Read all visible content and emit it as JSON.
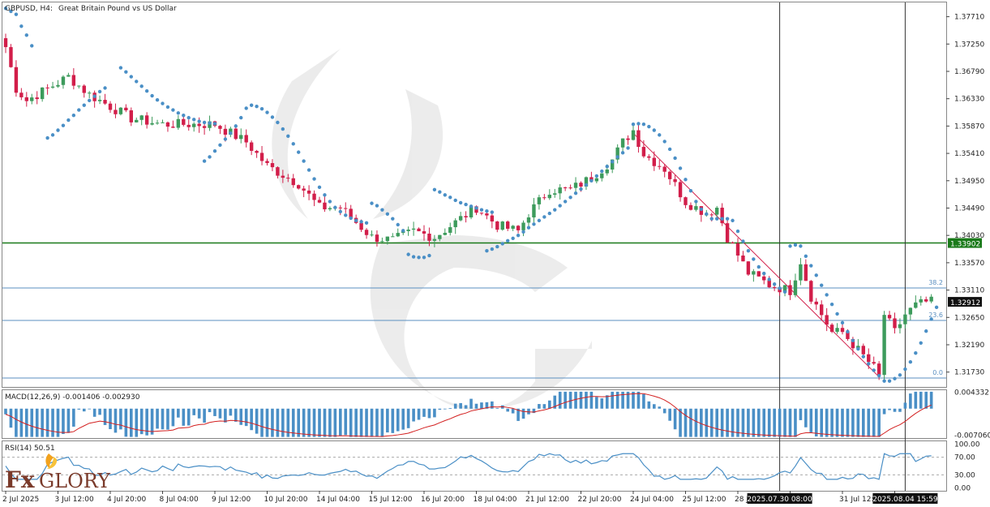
{
  "header": {
    "symbol": "GBPUSD, H4:",
    "description": "Great Britain Pound vs US Dollar"
  },
  "colors": {
    "bull": "#3d9b5c",
    "bear": "#d21e4a",
    "sar": "#4a8fc6",
    "macd_hist": "#4a8fc6",
    "signal": "#d32020",
    "rsi": "#4a8fc6",
    "level_line": "#1a7a1a",
    "fib": "#5b8fc0",
    "trendline": "#d21e4a"
  },
  "chart_data": [
    {
      "type": "candlestick",
      "title": "GBPUSD, H4:  Great Britain Pound vs US Dollar",
      "ylim": [
        1.3148,
        1.3795
      ],
      "y_ticks": [
        "1.37710",
        "1.37250",
        "1.36790",
        "1.36330",
        "1.35870",
        "1.35410",
        "1.34950",
        "1.34490",
        "1.34030",
        "1.33570",
        "1.33110",
        "1.32650",
        "1.32190",
        "1.31730"
      ],
      "y_tick_values": [
        1.3771,
        1.3725,
        1.3679,
        1.3633,
        1.3587,
        1.3541,
        1.3495,
        1.3449,
        1.3403,
        1.3357,
        1.3311,
        1.3265,
        1.3219,
        1.3173
      ],
      "x_ticks": [
        "2 Jul 2025",
        "3 Jul 12:00",
        "4 Jul 20:00",
        "8 Jul 04:00",
        "9 Jul 12:00",
        "10 Jul 20:00",
        "14 Jul 04:00",
        "15 Jul 12:00",
        "16 Jul 20:00",
        "18 Jul 04:00",
        "21 Jul 12:00",
        "22 Jul 20:00",
        "24 Jul 04:00",
        "25 Jul 12:00",
        "28 J",
        "",
        "31 Jul 12:00",
        ""
      ],
      "x_tick_bars": [
        0,
        10,
        20,
        30,
        40,
        50,
        60,
        70,
        80,
        90,
        100,
        110,
        120,
        130,
        140,
        150,
        160,
        170
      ],
      "crosshair_labels": [
        "2025.07.30 08:00",
        "2025.08.04 15:59"
      ],
      "crosshair_bars": [
        148,
        172
      ],
      "current_price_label": "1.32912",
      "current_price": 1.32912,
      "horizontal_level": {
        "label": "1.33902",
        "value": 1.33902
      },
      "fibonacci": [
        {
          "label": "38.2",
          "value": 1.33146
        },
        {
          "label": "23.6",
          "value": 1.326
        },
        {
          "label": "0.0",
          "value": 1.3163
        }
      ],
      "trendline": {
        "from": [
          120,
          1.3575
        ],
        "to": [
          167,
          1.3165
        ]
      },
      "parabolic_sar": [
        [
          0,
          1.3785
        ],
        [
          1,
          1.378
        ],
        [
          2,
          1.3775
        ],
        [
          3,
          1.3755
        ],
        [
          4,
          1.374
        ],
        [
          5,
          1.3722
        ],
        [
          8,
          1.3567
        ],
        [
          9,
          1.3572
        ],
        [
          10,
          1.358
        ],
        [
          11,
          1.3588
        ],
        [
          12,
          1.3597
        ],
        [
          13,
          1.3605
        ],
        [
          14,
          1.3614
        ],
        [
          15,
          1.3622
        ],
        [
          16,
          1.363
        ],
        [
          17,
          1.3637
        ],
        [
          18,
          1.3645
        ],
        [
          19,
          1.3651
        ],
        [
          22,
          1.3685
        ],
        [
          23,
          1.3678
        ],
        [
          24,
          1.367
        ],
        [
          25,
          1.3662
        ],
        [
          26,
          1.3654
        ],
        [
          27,
          1.3646
        ],
        [
          28,
          1.3638
        ],
        [
          29,
          1.3631
        ],
        [
          30,
          1.3625
        ],
        [
          31,
          1.3619
        ],
        [
          32,
          1.3614
        ],
        [
          33,
          1.3609
        ],
        [
          34,
          1.3605
        ],
        [
          35,
          1.3601
        ],
        [
          36,
          1.3598
        ],
        [
          37,
          1.3595
        ],
        [
          38,
          1.3593
        ],
        [
          39,
          1.3592
        ],
        [
          40,
          1.3591
        ],
        [
          38,
          1.3528
        ],
        [
          39,
          1.3535
        ],
        [
          40,
          1.3545
        ],
        [
          41,
          1.3555
        ],
        [
          42,
          1.3565
        ],
        [
          43,
          1.3575
        ],
        [
          44,
          1.3587
        ],
        [
          45,
          1.3601
        ],
        [
          46,
          1.3617
        ],
        [
          47,
          1.3622
        ],
        [
          48,
          1.362
        ],
        [
          49,
          1.3616
        ],
        [
          50,
          1.361
        ],
        [
          51,
          1.3602
        ],
        [
          52,
          1.3593
        ],
        [
          53,
          1.3582
        ],
        [
          54,
          1.357
        ],
        [
          55,
          1.3557
        ],
        [
          56,
          1.3543
        ],
        [
          57,
          1.3528
        ],
        [
          58,
          1.3513
        ],
        [
          59,
          1.3498
        ],
        [
          60,
          1.3484
        ],
        [
          61,
          1.3471
        ],
        [
          62,
          1.346
        ],
        [
          63,
          1.345
        ],
        [
          64,
          1.3443
        ],
        [
          65,
          1.3437
        ],
        [
          66,
          1.3432
        ],
        [
          67,
          1.3428
        ],
        [
          68,
          1.3426
        ],
        [
          69,
          1.3424
        ],
        [
          70,
          1.3457
        ],
        [
          71,
          1.3453
        ],
        [
          72,
          1.3446
        ],
        [
          73,
          1.3439
        ],
        [
          74,
          1.3431
        ],
        [
          75,
          1.3421
        ],
        [
          76,
          1.3411
        ],
        [
          77,
          1.3371
        ],
        [
          78,
          1.3367
        ],
        [
          79,
          1.3366
        ],
        [
          80,
          1.3366
        ],
        [
          81,
          1.3369
        ],
        [
          82,
          1.348
        ],
        [
          83,
          1.3476
        ],
        [
          84,
          1.3471
        ],
        [
          85,
          1.3467
        ],
        [
          86,
          1.3462
        ],
        [
          87,
          1.3458
        ],
        [
          88,
          1.3455
        ],
        [
          89,
          1.3452
        ],
        [
          90,
          1.3449
        ],
        [
          91,
          1.3446
        ],
        [
          92,
          1.3444
        ],
        [
          93,
          1.3442
        ],
        [
          92,
          1.3377
        ],
        [
          93,
          1.338
        ],
        [
          94,
          1.3384
        ],
        [
          95,
          1.3389
        ],
        [
          96,
          1.3394
        ],
        [
          97,
          1.3398
        ],
        [
          98,
          1.3403
        ],
        [
          99,
          1.3409
        ],
        [
          100,
          1.3416
        ],
        [
          101,
          1.3422
        ],
        [
          102,
          1.3428
        ],
        [
          103,
          1.3434
        ],
        [
          104,
          1.344
        ],
        [
          105,
          1.3446
        ],
        [
          106,
          1.3453
        ],
        [
          107,
          1.346
        ],
        [
          108,
          1.3467
        ],
        [
          109,
          1.3474
        ],
        [
          110,
          1.3481
        ],
        [
          111,
          1.3488
        ],
        [
          112,
          1.3495
        ],
        [
          113,
          1.3503
        ],
        [
          114,
          1.3511
        ],
        [
          115,
          1.3519
        ],
        [
          116,
          1.3527
        ],
        [
          117,
          1.3535
        ],
        [
          118,
          1.3542
        ],
        [
          119,
          1.355
        ],
        [
          120,
          1.359
        ],
        [
          121,
          1.3591
        ],
        [
          122,
          1.359
        ],
        [
          123,
          1.3586
        ],
        [
          124,
          1.358
        ],
        [
          125,
          1.3572
        ],
        [
          126,
          1.3561
        ],
        [
          127,
          1.3548
        ],
        [
          128,
          1.3533
        ],
        [
          129,
          1.3516
        ],
        [
          130,
          1.3497
        ],
        [
          131,
          1.3478
        ],
        [
          132,
          1.346
        ],
        [
          133,
          1.3447
        ],
        [
          134,
          1.3439
        ],
        [
          135,
          1.3431
        ],
        [
          136,
          1.3431
        ],
        [
          137,
          1.3431
        ],
        [
          138,
          1.3431
        ],
        [
          139,
          1.3428
        ],
        [
          140,
          1.341
        ],
        [
          141,
          1.3393
        ],
        [
          142,
          1.3377
        ],
        [
          143,
          1.3363
        ],
        [
          144,
          1.335
        ],
        [
          145,
          1.3339
        ],
        [
          146,
          1.3329
        ],
        [
          147,
          1.3321
        ],
        [
          148,
          1.3314
        ],
        [
          149,
          1.3308
        ],
        [
          150,
          1.3385
        ],
        [
          151,
          1.3387
        ],
        [
          152,
          1.3385
        ],
        [
          153,
          1.3368
        ],
        [
          154,
          1.3352
        ],
        [
          155,
          1.3336
        ],
        [
          156,
          1.3319
        ],
        [
          157,
          1.3303
        ],
        [
          158,
          1.3287
        ],
        [
          159,
          1.3271
        ],
        [
          160,
          1.3256
        ],
        [
          161,
          1.3241
        ],
        [
          162,
          1.3226
        ],
        [
          163,
          1.3212
        ],
        [
          164,
          1.3199
        ],
        [
          165,
          1.3187
        ],
        [
          166,
          1.3176
        ],
        [
          167,
          1.3167
        ],
        [
          168,
          1.3158
        ],
        [
          169,
          1.3158
        ],
        [
          170,
          1.3162
        ],
        [
          171,
          1.3168
        ],
        [
          172,
          1.3178
        ],
        [
          173,
          1.319
        ],
        [
          174,
          1.3205
        ],
        [
          175,
          1.3222
        ],
        [
          176,
          1.3242
        ],
        [
          177,
          1.3262
        ],
        [
          178,
          1.3282
        ]
      ]
    },
    {
      "type": "bar+line",
      "title": "MACD(12,26,9) -0.001406 -0.002930",
      "ylim": [
        -0.0078,
        0.0049
      ],
      "y_ticks": [
        "0.004332",
        "-0.007060"
      ],
      "y_tick_values": [
        0.004332,
        -0.00706
      ],
      "series": [
        {
          "name": "MACD",
          "style": "histogram"
        },
        {
          "name": "Signal",
          "style": "line"
        }
      ]
    },
    {
      "type": "line",
      "title": "RSI(14) 50.51",
      "ylim": [
        -6,
        106
      ],
      "y_ticks": [
        "100.00",
        "70.00",
        "30.00",
        "0.00"
      ],
      "y_tick_values": [
        100,
        70,
        30,
        0
      ],
      "levels": [
        70,
        30
      ],
      "series": [
        {
          "name": "RSI(14)"
        }
      ]
    }
  ],
  "watermark_logo": "FxGlory"
}
